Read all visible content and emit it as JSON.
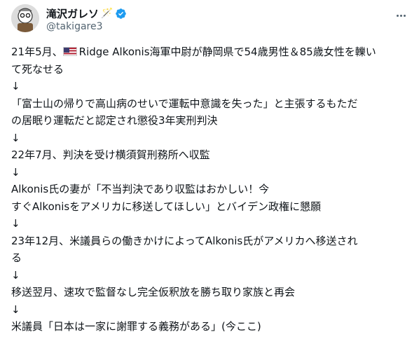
{
  "author": {
    "display_name": "滝沢ガレソ",
    "name_suffix_icon": "magic-wand-icon",
    "handle": "@takigare3",
    "verified": true
  },
  "tweet": {
    "lines": [
      "21年5月、",
      "Ridge Alkonis海軍中尉が静岡県で54歳男性＆85歳女性を轢い",
      "て死なせる",
      "↓",
      "「富士山の帰りで高山病のせいで運転中意識を失った」と主張するもただ",
      "の居眠り運転だと認定され懲役3年実刑判決",
      "↓",
      "22年7月、判決を受け横須賀刑務所へ収監",
      "↓",
      "Alkonis氏の妻が「不当判決であり収監はおかしい！今",
      "すぐAlkonisをアメリカに移送してほしい」とバイデン政権に懇願",
      "↓",
      "23年12月、米議員らの働きかけによってAlkonis氏がアメリカへ移送され",
      "る",
      "↓",
      "移送翌月、速攻で監督なし完全仮釈放を勝ち取り家族と再会",
      "↓",
      "米議員「日本は一家に謝罪する義務がある」(今ここ)"
    ]
  },
  "colors": {
    "text": "#0f1419",
    "secondary": "#536471",
    "verified": "#1d9bf0"
  }
}
